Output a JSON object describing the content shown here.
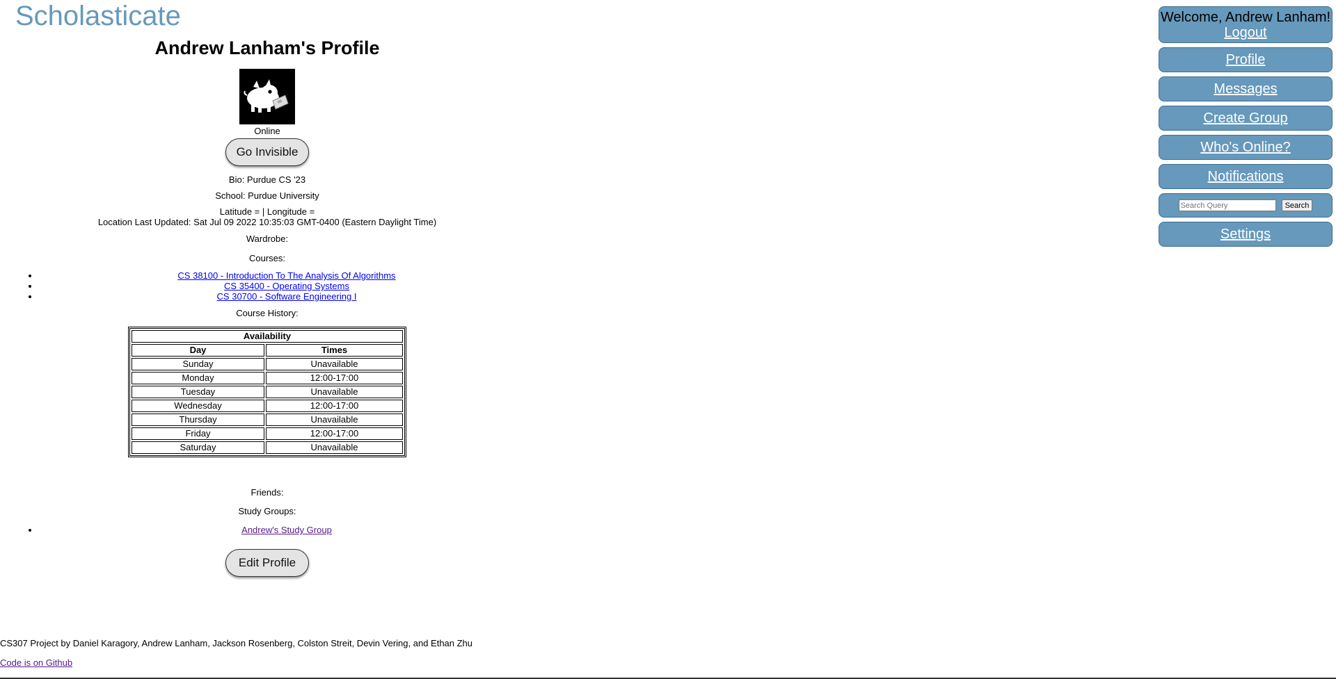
{
  "app": {
    "brand": "Scholasticate"
  },
  "profile": {
    "title": "Andrew Lanham's Profile",
    "status": "Online",
    "visibility_button": "Go Invisible",
    "bio": "Bio: Purdue CS '23",
    "school": "School: Purdue University",
    "coordinates": "Latitude = | Longitude =",
    "location_updated": "Location Last Updated: Sat Jul 09 2022 10:35:03 GMT-0400 (Eastern Daylight Time)",
    "wardrobe_label": "Wardrobe:",
    "courses_label": "Courses:",
    "courses": [
      "CS 38100 - Introduction To The Analysis Of Algorithms",
      "CS 35400 - Operating Systems",
      "CS 30700 - Software Engineering I"
    ],
    "course_history_label": "Course History:",
    "availability": {
      "caption": "Availability",
      "headers": [
        "Day",
        "Times"
      ],
      "rows": [
        [
          "Sunday",
          "Unavailable"
        ],
        [
          "Monday",
          "12:00-17:00"
        ],
        [
          "Tuesday",
          "Unavailable"
        ],
        [
          "Wednesday",
          "12:00-17:00"
        ],
        [
          "Thursday",
          "Unavailable"
        ],
        [
          "Friday",
          "12:00-17:00"
        ],
        [
          "Saturday",
          "Unavailable"
        ]
      ]
    },
    "friends_label": "Friends:",
    "study_groups_label": "Study Groups:",
    "study_groups": [
      "Andrew's Study Group"
    ],
    "edit_button": "Edit Profile"
  },
  "footer": {
    "credits": "CS307 Project by Daniel Karagory, Andrew Lanham, Jackson Rosenberg, Colston Streit, Devin Vering, and Ethan Zhu",
    "github_link": "Code is on Github"
  },
  "sidebar": {
    "welcome": "Welcome, Andrew Lanham!",
    "logout": "Logout",
    "nav": {
      "profile": "Profile",
      "messages": "Messages",
      "create_group": "Create Group",
      "whos_online": "Who's Online?",
      "notifications": "Notifications",
      "settings": "Settings"
    },
    "search": {
      "placeholder": "Search Query",
      "button": "Search"
    }
  },
  "colors": {
    "brand": "#6699bb",
    "nav_background": "#6699bb",
    "link": "#0000ee",
    "visited_link": "#551a8b"
  }
}
